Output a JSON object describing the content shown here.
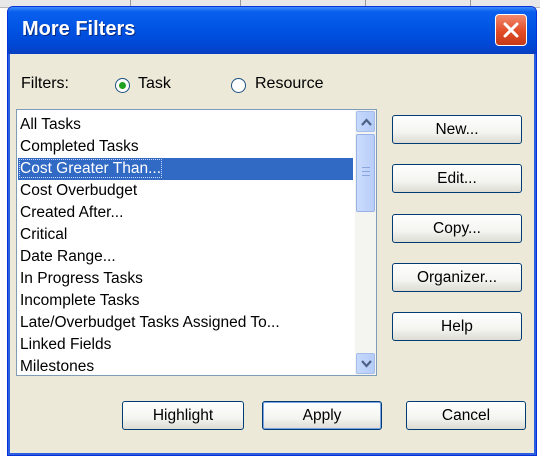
{
  "window": {
    "title": "More Filters"
  },
  "filters": {
    "label": "Filters:",
    "task_option": "Task",
    "resource_option": "Resource",
    "selected_option": "Task"
  },
  "list": {
    "items": [
      "All Tasks",
      "Completed Tasks",
      "Cost Greater Than...",
      "Cost Overbudget",
      "Created After...",
      "Critical",
      "Date Range...",
      "In Progress Tasks",
      "Incomplete Tasks",
      "Late/Overbudget Tasks Assigned To...",
      "Linked Fields",
      "Milestones"
    ],
    "selected_item": "Cost Greater Than..."
  },
  "side_buttons": {
    "new": "New...",
    "edit": "Edit...",
    "copy": "Copy...",
    "organizer": "Organizer...",
    "help": "Help"
  },
  "bottom_buttons": {
    "highlight": "Highlight",
    "apply": "Apply",
    "cancel": "Cancel"
  },
  "colors": {
    "titlebar": "#0054e3",
    "dialog_bg": "#ece9d8",
    "selection": "#316ac5",
    "close_button": "#e24b26"
  }
}
